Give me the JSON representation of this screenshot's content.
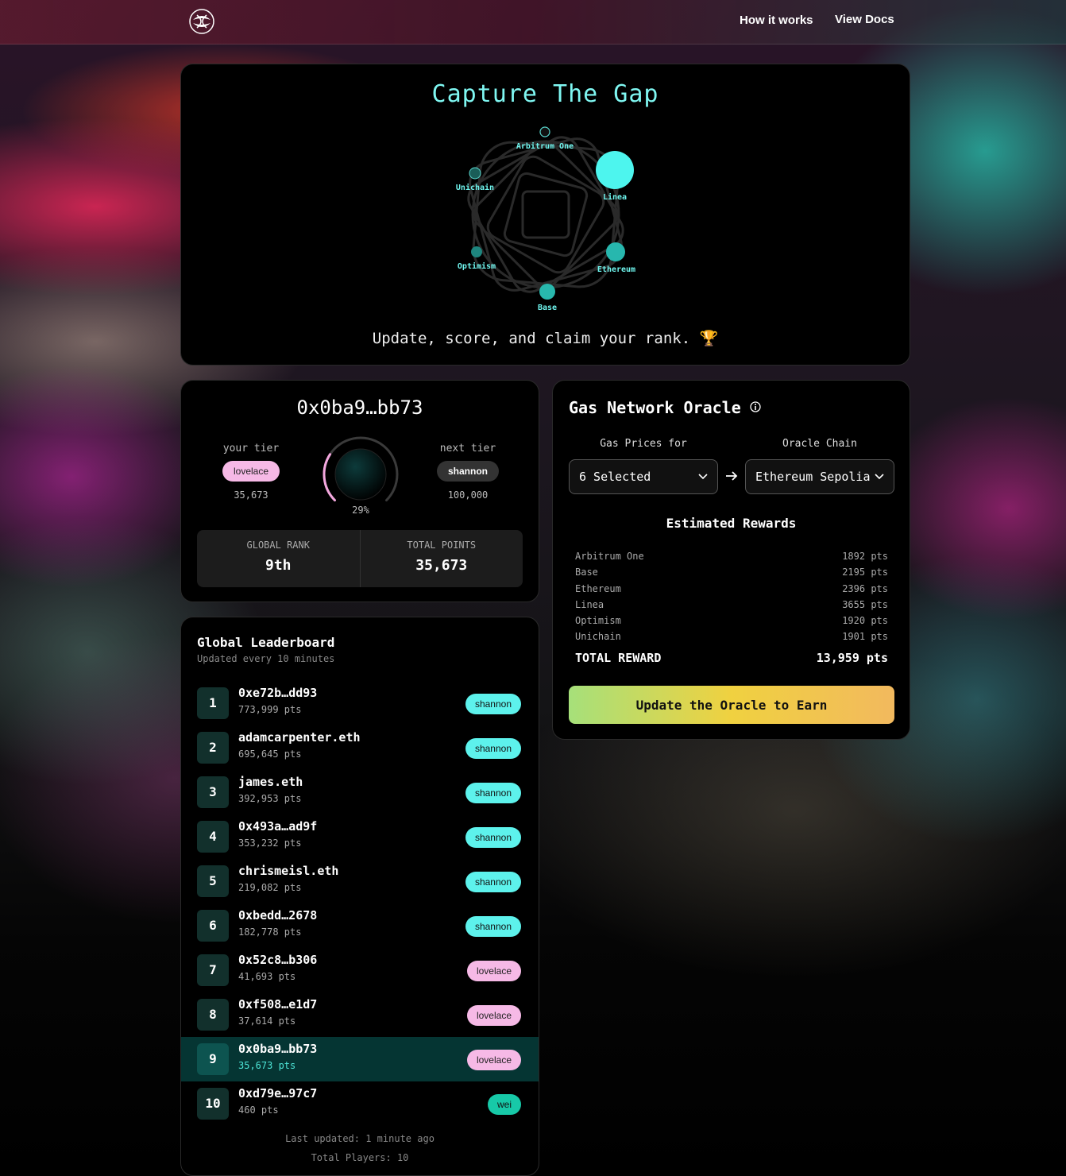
{
  "nav": {
    "how_it_works": "How it works",
    "view_docs": "View Docs"
  },
  "hero": {
    "title": "Capture The Gap",
    "subtitle": "Update, score, and claim your rank. 🏆",
    "networks": [
      "Arbitrum One",
      "Linea",
      "Ethereum",
      "Base",
      "Optimism",
      "Unichain"
    ]
  },
  "profile": {
    "address": "0x0ba9…bb73",
    "your_tier_label": "your tier",
    "your_tier": "lovelace",
    "your_tier_points": "35,673",
    "next_tier_label": "next tier",
    "next_tier": "shannon",
    "next_tier_points": "100,000",
    "progress_label": "29%",
    "progress": 0.29,
    "global_rank_label": "GLOBAL RANK",
    "global_rank": "9th",
    "total_points_label": "TOTAL POINTS",
    "total_points": "35,673"
  },
  "oracle": {
    "title": "Gas Network Oracle",
    "gas_prices_label": "Gas Prices for",
    "gas_prices_value": "6 Selected",
    "oracle_chain_label": "Oracle Chain",
    "oracle_chain_value": "Ethereum Sepolia",
    "estimated_title": "Estimated Rewards",
    "rewards": [
      {
        "chain": "Arbitrum One",
        "pts": "1892 pts"
      },
      {
        "chain": "Base",
        "pts": "2195 pts"
      },
      {
        "chain": "Ethereum",
        "pts": "2396 pts"
      },
      {
        "chain": "Linea",
        "pts": "3655 pts"
      },
      {
        "chain": "Optimism",
        "pts": "1920 pts"
      },
      {
        "chain": "Unichain",
        "pts": "1901 pts"
      }
    ],
    "total_label": "TOTAL REWARD",
    "total_value": "13,959 pts",
    "cta": "Update the Oracle to Earn"
  },
  "leaderboard": {
    "title": "Global Leaderboard",
    "subtitle": "Updated every 10 minutes",
    "rows": [
      {
        "rank": "1",
        "name": "0xe72b…dd93",
        "pts": "773,999 pts",
        "tier": "shannon"
      },
      {
        "rank": "2",
        "name": "adamcarpenter.eth",
        "pts": "695,645 pts",
        "tier": "shannon"
      },
      {
        "rank": "3",
        "name": "james.eth",
        "pts": "392,953 pts",
        "tier": "shannon"
      },
      {
        "rank": "4",
        "name": "0x493a…ad9f",
        "pts": "353,232 pts",
        "tier": "shannon"
      },
      {
        "rank": "5",
        "name": "chrismeisl.eth",
        "pts": "219,082 pts",
        "tier": "shannon"
      },
      {
        "rank": "6",
        "name": "0xbedd…2678",
        "pts": "182,778 pts",
        "tier": "shannon"
      },
      {
        "rank": "7",
        "name": "0x52c8…b306",
        "pts": "41,693 pts",
        "tier": "lovelace"
      },
      {
        "rank": "8",
        "name": "0xf508…e1d7",
        "pts": "37,614 pts",
        "tier": "lovelace"
      },
      {
        "rank": "9",
        "name": "0x0ba9…bb73",
        "pts": "35,673 pts",
        "tier": "lovelace"
      },
      {
        "rank": "10",
        "name": "0xd79e…97c7",
        "pts": "460 pts",
        "tier": "wei"
      }
    ],
    "last_updated": "Last updated: 1 minute ago",
    "total_players": "Total Players: 10"
  }
}
